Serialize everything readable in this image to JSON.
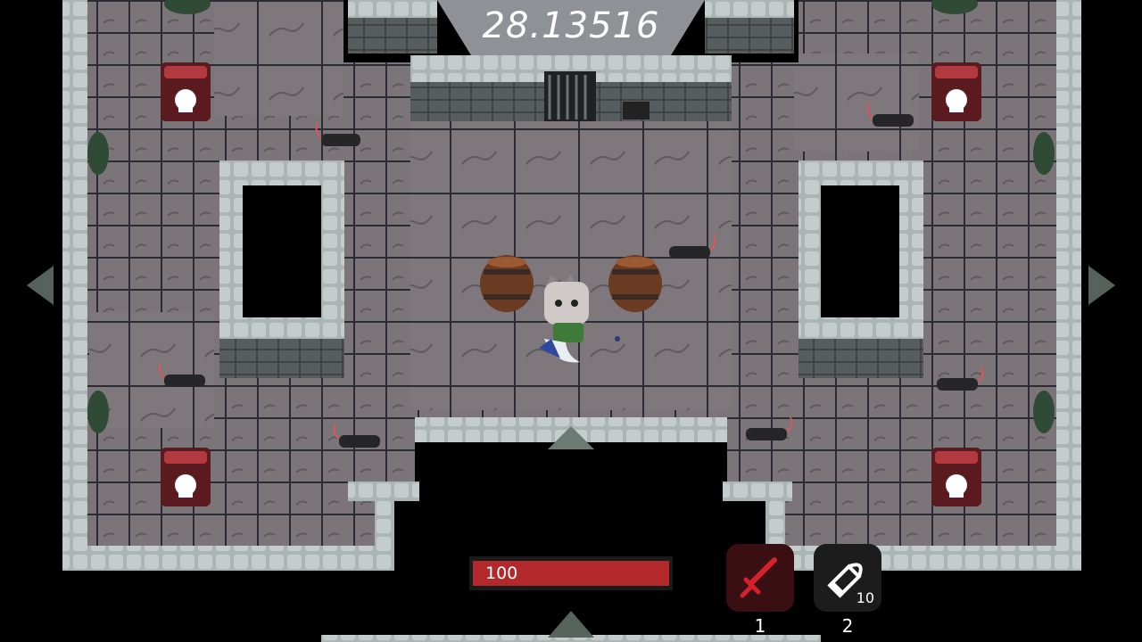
{
  "hud": {
    "timer": "28.13516",
    "health": {
      "value_label": "100",
      "fraction": 1.0
    },
    "slots": [
      {
        "icon": "sword-icon",
        "count": "",
        "key": "1",
        "bg": "#3a0f14",
        "icon_color": "#d6212c"
      },
      {
        "icon": "bullet-icon",
        "count": "10",
        "key": "2",
        "bg": "#1c1c1c",
        "icon_color": "#ffffff"
      }
    ]
  },
  "colors": {
    "floor": "#7b7479",
    "floor_tile_line": "#2b2b33",
    "wall_top": "#b9c3c2",
    "wall_face": "#4b4f51",
    "pit": "#000000",
    "health": "#b3282a",
    "timer_panel": "#8e9297"
  },
  "entities": {
    "player": "cat-player",
    "rats": 8,
    "barrels": 2,
    "skull_crates": 4
  }
}
